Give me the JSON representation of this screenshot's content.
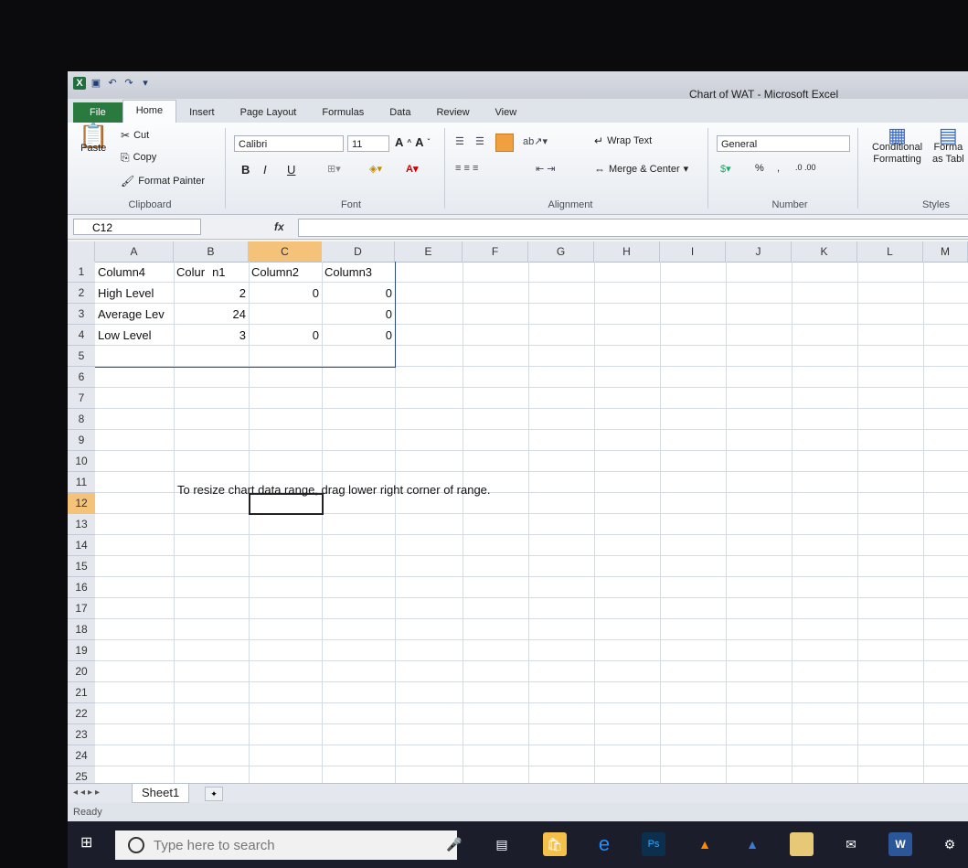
{
  "window": {
    "title": "Chart of WAT - Microsoft Excel"
  },
  "quick_access": {
    "icons": [
      "excel-icon",
      "save-icon",
      "undo-icon",
      "redo-icon",
      "customize-icon"
    ]
  },
  "tabs": [
    "File",
    "Home",
    "Insert",
    "Page Layout",
    "Formulas",
    "Data",
    "Review",
    "View"
  ],
  "ribbon": {
    "clipboard": {
      "paste": "Paste",
      "cut": "Cut",
      "copy": "Copy",
      "format_painter": "Format Painter",
      "label": "Clipboard"
    },
    "font": {
      "name": "Calibri",
      "size": "11",
      "label": "Font",
      "bold": "B",
      "italic": "I",
      "underline": "U"
    },
    "alignment": {
      "wrap_text": "Wrap Text",
      "merge_center": "Merge & Center",
      "label": "Alignment"
    },
    "number": {
      "format": "General",
      "percent": "%",
      "comma": ",",
      "label": "Number"
    },
    "styles": {
      "conditional": "Conditional",
      "formatting": "Formatting",
      "format_as": "Forma",
      "as_table": "as Tabl",
      "label": "Styles"
    }
  },
  "formula_bar": {
    "name_box": "C12",
    "fx": "fx",
    "formula": ""
  },
  "columns": [
    "A",
    "B",
    "C",
    "D",
    "E",
    "F",
    "G",
    "H",
    "I",
    "J",
    "K",
    "L",
    "M"
  ],
  "selected_column": "C",
  "rows": [
    "1",
    "2",
    "3",
    "4",
    "5",
    "6",
    "7",
    "8",
    "9",
    "10",
    "11",
    "12",
    "13",
    "14",
    "15",
    "16",
    "17",
    "18",
    "19",
    "20",
    "21",
    "22",
    "23",
    "24",
    "25"
  ],
  "selected_row": "12",
  "cells": {
    "A1": "Column4",
    "B1": "Colur",
    "B1b": "n1",
    "C1": "Column2",
    "D1": "Column3",
    "A2": "High Level",
    "B2": "2",
    "C2": "0",
    "D2": "0",
    "A3": "Average Lev",
    "B3": "24",
    "D3": "0",
    "A4": "Low Level",
    "B4": "3",
    "C4": "0",
    "D4": "0"
  },
  "hint_text": "To resize chart data range, drag lower right corner of range.",
  "sheets": [
    "Sheet1"
  ],
  "status": "Ready",
  "taskbar": {
    "search_placeholder": "Type here to search"
  }
}
